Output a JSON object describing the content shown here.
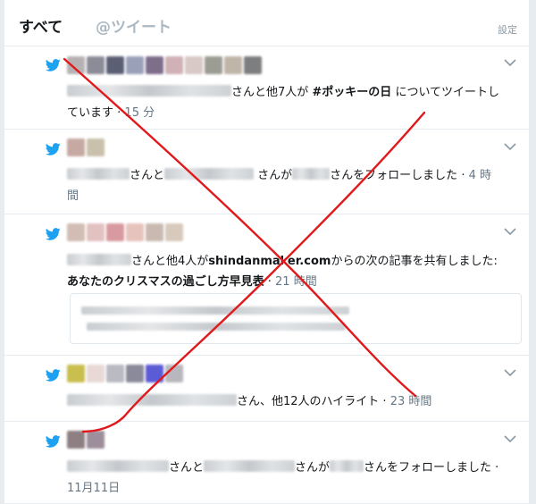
{
  "tabs": {
    "all": "すべて",
    "mentions": "@ツイート",
    "settings": "設定"
  },
  "notifications": [
    {
      "after": "さんと他7人が ",
      "hashtag": "#ポッキーの日",
      "after2": " についてツイートしています",
      "time": "15 分"
    },
    {
      "p1": "さんと",
      "p2": "さんが",
      "p3": "さんをフォローしました",
      "time": "4 時間"
    },
    {
      "p1": "さんと他4人が",
      "site": "shindanmaker.com",
      "p2": "からの次の記事を共有しました: ",
      "article": "あなたのクリスマスの過ごし方早見表",
      "time": "21 時間"
    },
    {
      "p1": "さん、他12人のハイライト",
      "time": "23 時間"
    },
    {
      "p1": "さんと",
      "p2": "さんが",
      "p3": "さんをフォローしました",
      "time": "11月11日"
    }
  ],
  "colors": {
    "accent": "#1da1f2",
    "annotation": "#e0191c"
  },
  "icons": {
    "bird": "twitter-bird-icon",
    "chevron": "chevron-down-icon"
  }
}
